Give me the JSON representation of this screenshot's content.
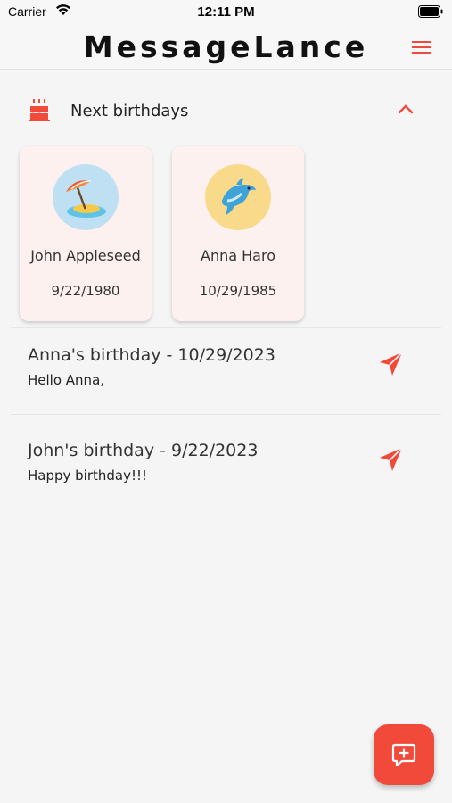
{
  "status_bar": {
    "carrier": "Carrier",
    "time": "12:11 PM"
  },
  "header": {
    "title": "MessageLance",
    "menu_icon": "menu-icon"
  },
  "birthdays_section": {
    "title": "Next birthdays",
    "icon": "cake-icon",
    "expanded": true,
    "contacts": [
      {
        "name": "John Appleseed",
        "date": "9/22/1980",
        "avatar_icon": "beach-umbrella-icon"
      },
      {
        "name": "Anna Haro",
        "date": "10/29/1985",
        "avatar_icon": "dolphin-icon"
      }
    ]
  },
  "messages": [
    {
      "title": "Anna's birthday - 10/29/2023",
      "body": "Hello Anna,"
    },
    {
      "title": "John's birthday - 9/22/2023",
      "body": "Happy birthday!!!"
    }
  ],
  "colors": {
    "accent": "#f24a3a",
    "card_background": "#fdf1ef",
    "page_background": "#f5f5f5"
  }
}
